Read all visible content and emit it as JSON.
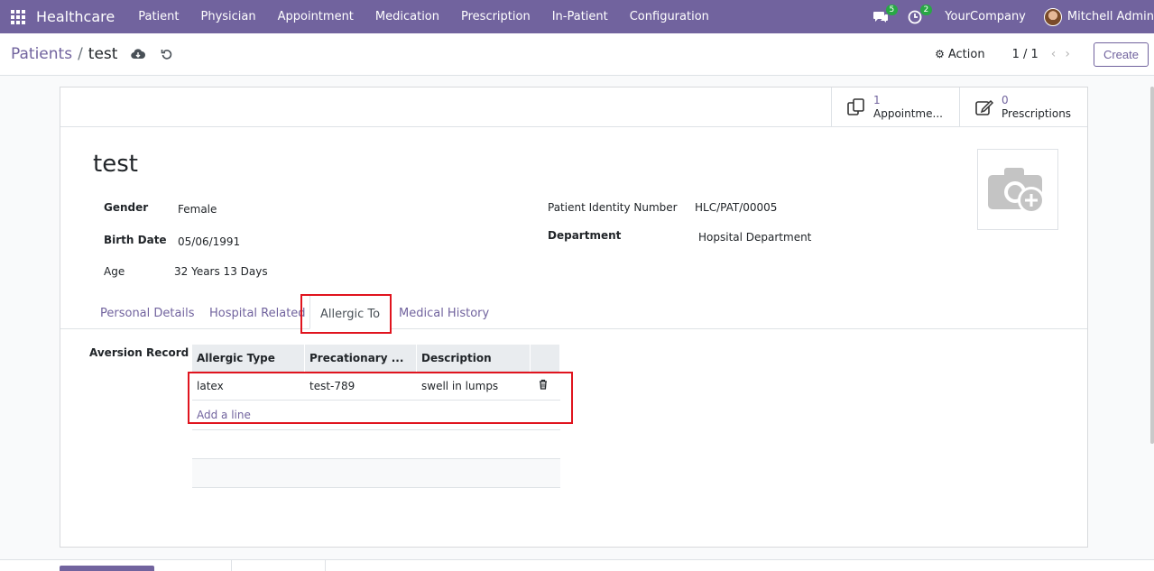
{
  "navbar": {
    "brand": "Healthcare",
    "menu": [
      "Patient",
      "Physician",
      "Appointment",
      "Medication",
      "Prescription",
      "In-Patient",
      "Configuration"
    ],
    "messages_count": "5",
    "activities_count": "2",
    "company": "YourCompany",
    "user": "Mitchell Admin"
  },
  "control_panel": {
    "breadcrumb_parent": "Patients",
    "breadcrumb_separator": "/",
    "breadcrumb_current": "test",
    "action_label": "Action",
    "pager": "1 / 1",
    "create_label": "Create"
  },
  "smart_buttons": [
    {
      "count": "1",
      "label": "Appointme...",
      "icon": "appointments-icon"
    },
    {
      "count": "0",
      "label": "Prescriptions",
      "icon": "prescription-edit-icon"
    }
  ],
  "record": {
    "name": "test",
    "gender_label": "Gender",
    "gender_value": "Female",
    "birth_date_label": "Birth Date",
    "birth_date_value": "05/06/1991",
    "age_label": "Age",
    "age_value": "32 Years 13 Days",
    "identity_label": "Patient Identity Number",
    "identity_value": "HLC/PAT/00005",
    "department_label": "Department",
    "department_value": "Hopsital Department"
  },
  "tabs": [
    "Personal Details",
    "Hospital Related",
    "Allergic To",
    "Medical History"
  ],
  "active_tab": "Allergic To",
  "aversion": {
    "label": "Aversion Record",
    "columns": [
      "Allergic Type",
      "Precationary ...",
      "Description"
    ],
    "rows": [
      {
        "type": "latex",
        "precautionary": "test-789",
        "description": "swell in lumps"
      }
    ],
    "add_line": "Add a line"
  },
  "colors": {
    "brand": "#71639e",
    "highlight": "#e0141e",
    "badge": "#28a745"
  }
}
